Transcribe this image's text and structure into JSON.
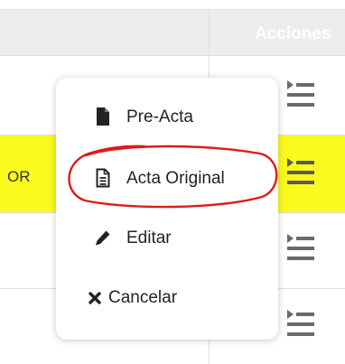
{
  "table": {
    "header": {
      "actions_label": "Acciones"
    },
    "rows": [
      {
        "text": ""
      },
      {
        "text": "OR"
      },
      {
        "text": ""
      },
      {
        "text": ""
      }
    ],
    "row_highlight_color": "#fafa1e",
    "row_action_icon": "list-menu-icon"
  },
  "menu": {
    "items": [
      {
        "label": "Pre-Acta",
        "icon": "file-solid-icon"
      },
      {
        "label": "Acta Original",
        "icon": "file-text-icon"
      },
      {
        "label": "Editar",
        "icon": "pencil-icon"
      },
      {
        "label": "Cancelar",
        "icon": "close-icon"
      }
    ]
  },
  "annotation": {
    "color": "#e01a1a"
  }
}
